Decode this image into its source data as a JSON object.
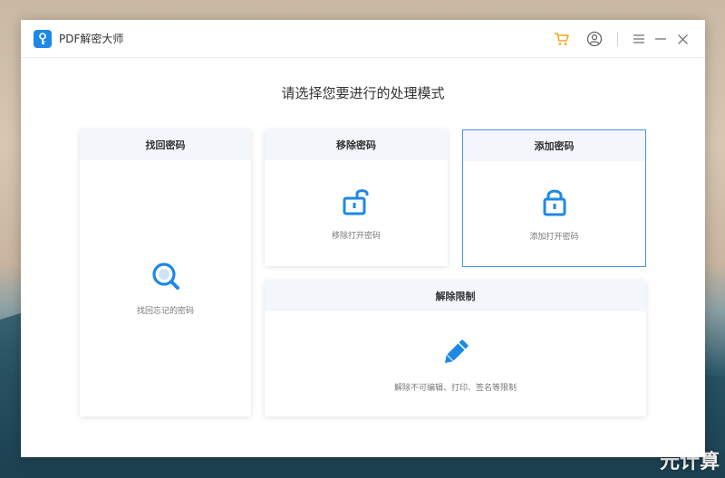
{
  "window": {
    "title": "PDF解密大师"
  },
  "main": {
    "heading": "请选择您要进行的处理模式",
    "cards": [
      {
        "title": "找回密码",
        "description": "找回忘记的密码",
        "icon": "search-icon"
      },
      {
        "title": "移除密码",
        "description": "移除打开密码",
        "icon": "unlock-icon"
      },
      {
        "title": "添加密码",
        "description": "添加打开密码",
        "icon": "lock-icon",
        "selected": true
      },
      {
        "title": "解除限制",
        "description": "解除不可编辑、打印、签名等限制",
        "icon": "pencil-icon"
      }
    ]
  },
  "colors": {
    "accent": "#1e88e5",
    "cart": "#f5a623",
    "selected_border": "#4a90e2"
  },
  "watermark": "元计算"
}
